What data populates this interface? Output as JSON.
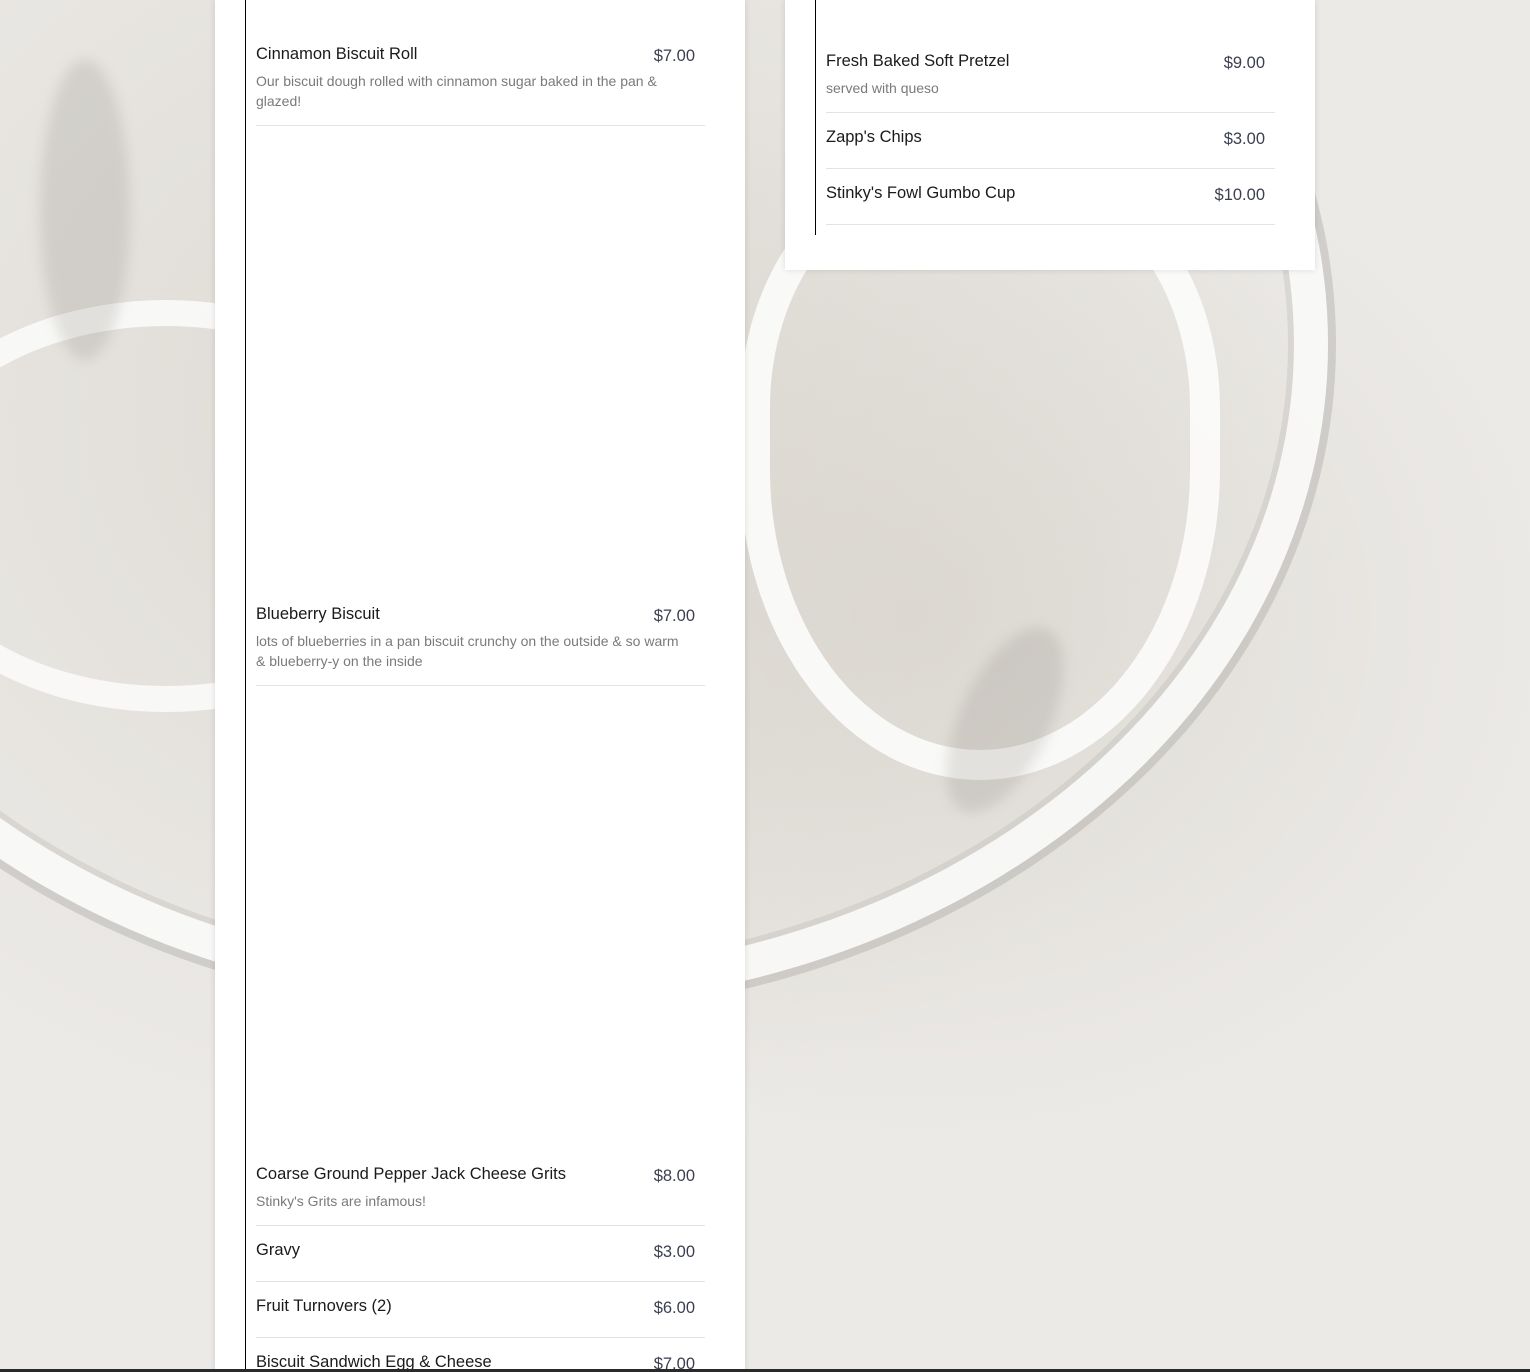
{
  "left_menu": {
    "items": [
      {
        "name": "Cinnamon Biscuit Roll",
        "price": "$7.00",
        "description": "Our biscuit dough rolled with cinnamon sugar baked in the pan & glazed!"
      },
      {
        "name": "Blueberry Biscuit",
        "price": "$7.00",
        "description": "lots of blueberries in a pan biscuit crunchy on the outside & so warm & blueberry-y on the inside"
      },
      {
        "name": "Coarse Ground Pepper Jack Cheese Grits",
        "price": "$8.00",
        "description": "Stinky's Grits are infamous!"
      },
      {
        "name": "Gravy",
        "price": "$3.00"
      },
      {
        "name": "Fruit Turnovers (2)",
        "price": "$6.00"
      },
      {
        "name": "Biscuit Sandwich Egg & Cheese",
        "price": "$7.00"
      }
    ]
  },
  "right_menu": {
    "items": [
      {
        "name": "Fresh Baked Soft Pretzel",
        "price": "$9.00",
        "description": "served with queso"
      },
      {
        "name": "Zapp's Chips",
        "price": "$3.00"
      },
      {
        "name": "Stinky's Fowl Gumbo Cup",
        "price": "$10.00"
      }
    ]
  }
}
